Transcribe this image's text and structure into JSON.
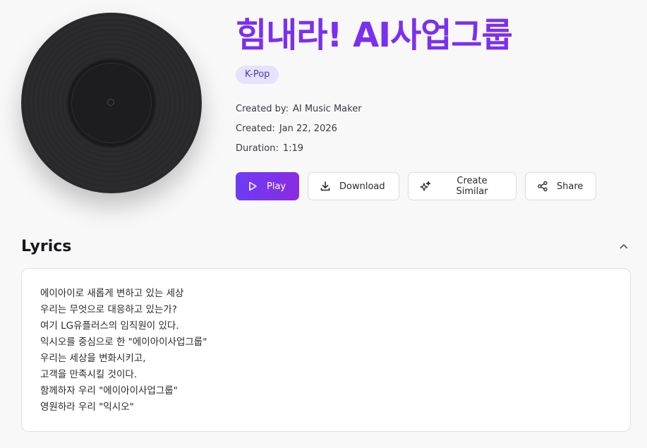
{
  "song": {
    "title": "힘내라! AI사업그룹",
    "genre": "K-Pop",
    "created_by_label": "Created by:",
    "created_by": "AI Music Maker",
    "created_label": "Created:",
    "created": "Jan 22, 2026",
    "duration_label": "Duration:",
    "duration": "1:19"
  },
  "actions": {
    "play": "Play",
    "download": "Download",
    "create_similar": "Create Similar",
    "share": "Share"
  },
  "lyrics": {
    "heading": "Lyrics",
    "lines": [
      "에이아이로 새롭게 변하고 있는 세상",
      "우리는 무엇으로 대응하고 있는가?",
      "여기 LG유플러스의 임직원이 있다.",
      "익시오를 중심으로 한 \"에이아이사업그룹\"",
      "우리는 세상을 변화시키고,",
      "고객을 만족시킬 것이다.",
      "함께하자 우리 \"에이아이사업그룹\"",
      "영원하라 우리 \"익시오\""
    ]
  },
  "icons": {
    "play": "play-icon",
    "download": "download-icon",
    "create_similar": "sparkles-icon",
    "share": "share-icon",
    "collapse": "chevron-up-icon"
  },
  "colors": {
    "accent": "#7c2ff0",
    "tag_bg": "#e6e2fb",
    "background": "#f8f8f9"
  }
}
